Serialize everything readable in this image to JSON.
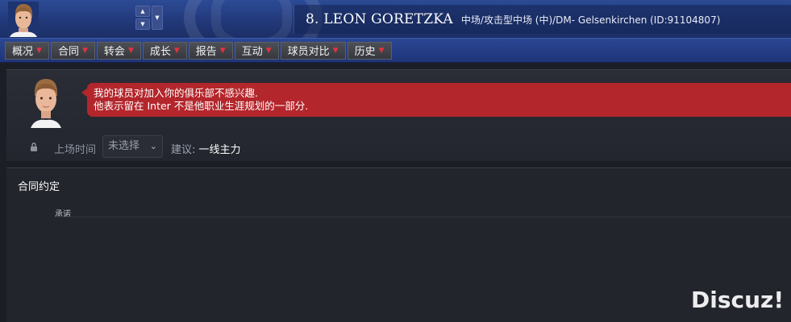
{
  "header": {
    "player_title": "8. LEON GORETZKA",
    "player_meta": "中场/攻击型中场 (中)/DM- Gelsenkirchen (ID:91104807)"
  },
  "tabs": [
    {
      "label": "概况"
    },
    {
      "label": "合同"
    },
    {
      "label": "转会"
    },
    {
      "label": "成长"
    },
    {
      "label": "报告"
    },
    {
      "label": "互动"
    },
    {
      "label": "球员对比"
    },
    {
      "label": "历史"
    }
  ],
  "message": {
    "line1": "我的球员对加入你的俱乐部不感兴趣.",
    "line2": "他表示留在 Inter 不是他职业生涯规划的一部分."
  },
  "playing_time": {
    "label": "上场时间",
    "select_value": "未选择",
    "advice_label": "建议:",
    "advice_value": "一线主力"
  },
  "contract": {
    "title": "合同约定",
    "promises_label": "承诺"
  },
  "watermark": "Discuz!",
  "colors": {
    "header_blue": "#22397a",
    "bubble_red": "#b3262b",
    "caret_red": "#e0333f",
    "bg_dark": "#1c1e26"
  },
  "icons": {
    "lock": "lock-icon",
    "chevron": "chevron-down-icon",
    "caret": "caret-down-icon"
  }
}
